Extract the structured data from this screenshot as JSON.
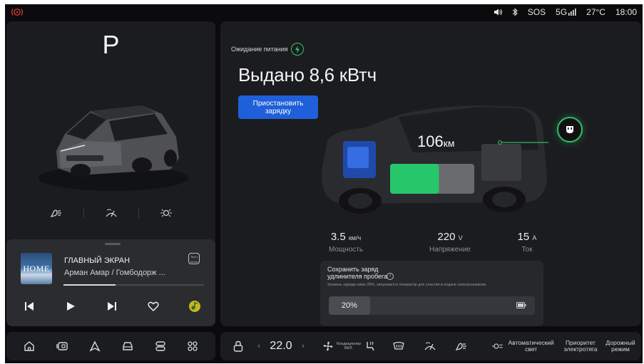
{
  "status_bar": {
    "sos": "SOS",
    "network": "5G",
    "temperature": "27°C",
    "time": "18:00",
    "icons": [
      "alert-ring-icon",
      "volume-icon",
      "bluetooth-icon",
      "signal-icon"
    ],
    "alert_color": "#d03a2f"
  },
  "left_panel": {
    "gear": "P",
    "drive_icons": [
      "headlight-icon",
      "wiper-icon",
      "parking-light-icon"
    ]
  },
  "music": {
    "album_text": "HOME",
    "title": "ГЛАВНЫЙ ЭКРАН",
    "artist": "Арман Амар / Гомбодорж ...",
    "lyrics_label": "Текст песни",
    "progress": 0.37,
    "controls": [
      "previous-icon",
      "play-icon",
      "next-icon",
      "heart-icon",
      "music-app-icon"
    ]
  },
  "charging": {
    "status": "Ожидание питания",
    "delivered": "Выдано 8,6 кВтч",
    "pause_button": "Приостановить зарядку",
    "range_value": "106",
    "range_unit": "км",
    "battery_level": 0.58,
    "metrics": [
      {
        "value": "3.5",
        "unit": "км/ч",
        "label": "Мощность"
      },
      {
        "value": "220",
        "unit": "V",
        "label": "Напряжение"
      },
      {
        "value": "15",
        "unit": "A",
        "label": "Ток"
      }
    ],
    "extender": {
      "title": "Сохранить заряд удлинителя пробега",
      "description": "Уровень заряда ниже 20%, запускается генератор для участия в подаче электроэнергии.",
      "value_label": "20%",
      "value": 0.2
    },
    "colors": {
      "accent_blue": "#1f5fd9",
      "charge_green": "#2fbf66"
    }
  },
  "bottom_left": {
    "icons": [
      "home-icon",
      "media-icon",
      "navigation-icon",
      "car-icon",
      "settings-icon",
      "apps-icon"
    ]
  },
  "bottom_right": {
    "temperature": "22.0",
    "ac_label": "Кондиционер ВКЛ.",
    "auto_light": "Автоматический свет",
    "priority": "Приоритет электротяга",
    "road_mode": "Дорожный режим"
  }
}
